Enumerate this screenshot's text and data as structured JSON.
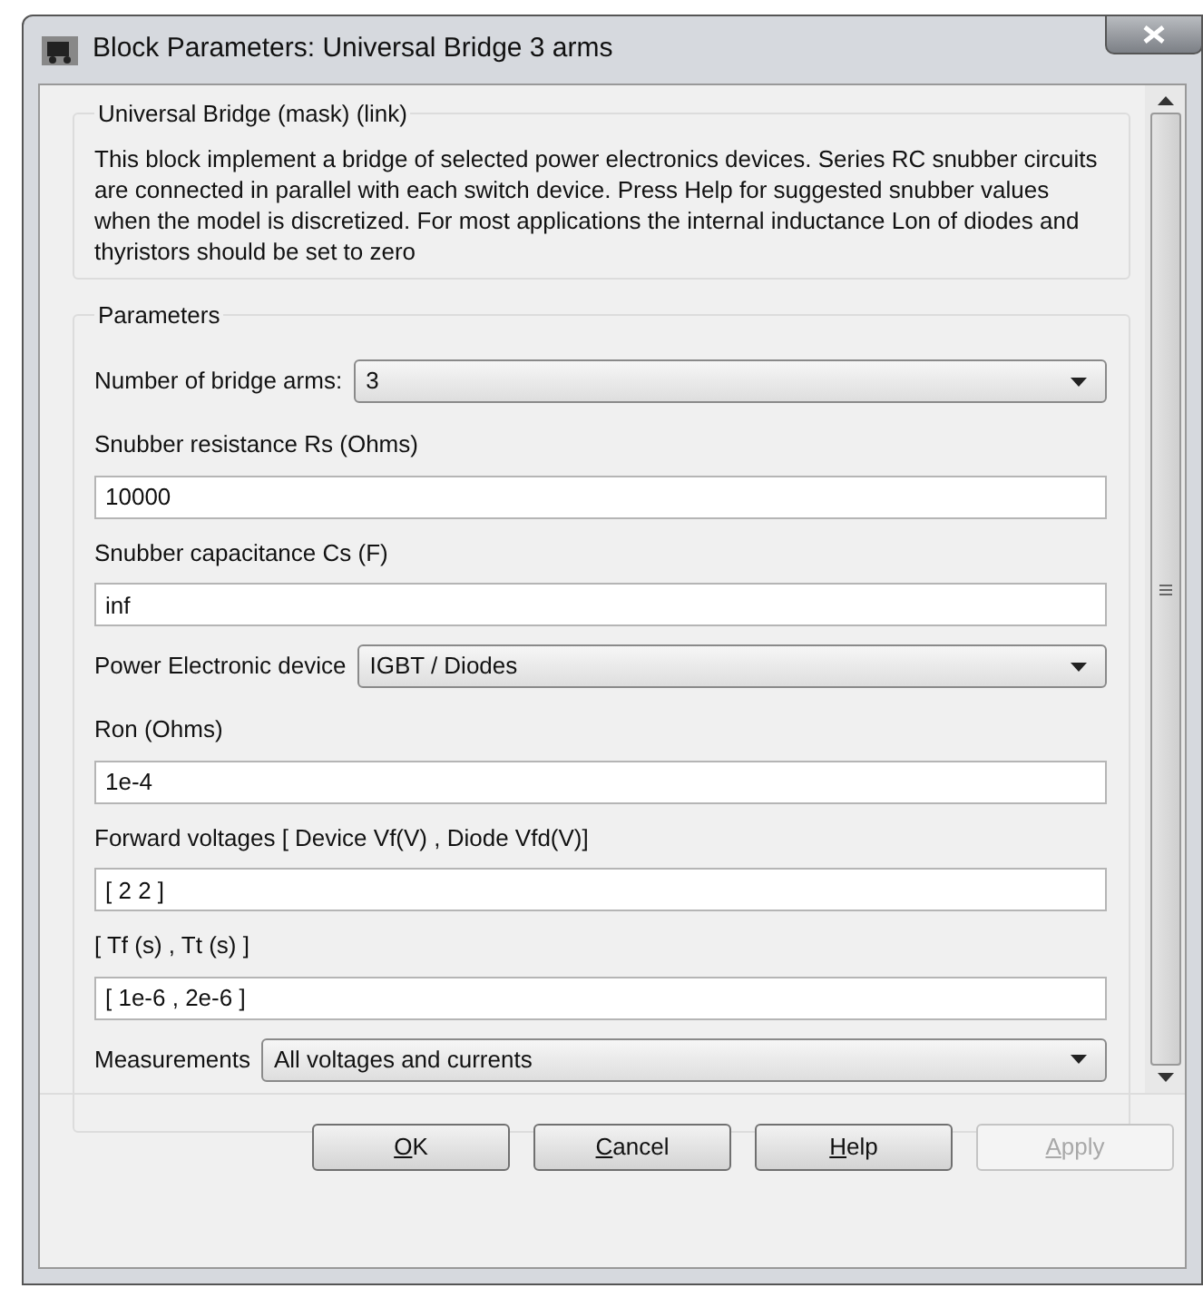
{
  "window": {
    "title": "Block Parameters: Universal Bridge 3 arms"
  },
  "description_group": {
    "legend": "Universal Bridge (mask) (link)",
    "text": "This block implement a bridge of selected power electronics devices.  Series RC snubber circuits are connected in parallel with each switch device.  Press Help for suggested snubber values when the model is discretized. For most applications the internal inductance Lon of diodes and thyristors should be set to zero"
  },
  "parameters_group": {
    "legend": "Parameters",
    "items": [
      {
        "kind": "dropdown",
        "label": "Number of bridge arms:",
        "value": "3"
      },
      {
        "kind": "text",
        "label": "Snubber resistance Rs (Ohms)",
        "value": "10000"
      },
      {
        "kind": "text",
        "label": "Snubber capacitance Cs (F)",
        "value": "inf"
      },
      {
        "kind": "dropdown",
        "label": "Power Electronic device",
        "value": "IGBT / Diodes"
      },
      {
        "kind": "text",
        "label": "Ron (Ohms)",
        "value": "1e-4"
      },
      {
        "kind": "text",
        "label": "Forward voltages  [ Device Vf(V) , Diode Vfd(V)]",
        "value": "[ 2 2 ]"
      },
      {
        "kind": "text",
        "label": "[ Tf (s) , Tt (s) ]",
        "value": "[ 1e-6 , 2e-6 ]"
      },
      {
        "kind": "dropdown",
        "label": "Measurements",
        "value": "All voltages and currents"
      }
    ]
  },
  "buttons": [
    {
      "mnemonic": "O",
      "rest": "K",
      "disabled": false
    },
    {
      "mnemonic": "C",
      "rest": "ancel",
      "disabled": false
    },
    {
      "mnemonic": "H",
      "rest": "elp",
      "disabled": false
    },
    {
      "mnemonic": "A",
      "rest": "pply",
      "disabled": true
    }
  ]
}
